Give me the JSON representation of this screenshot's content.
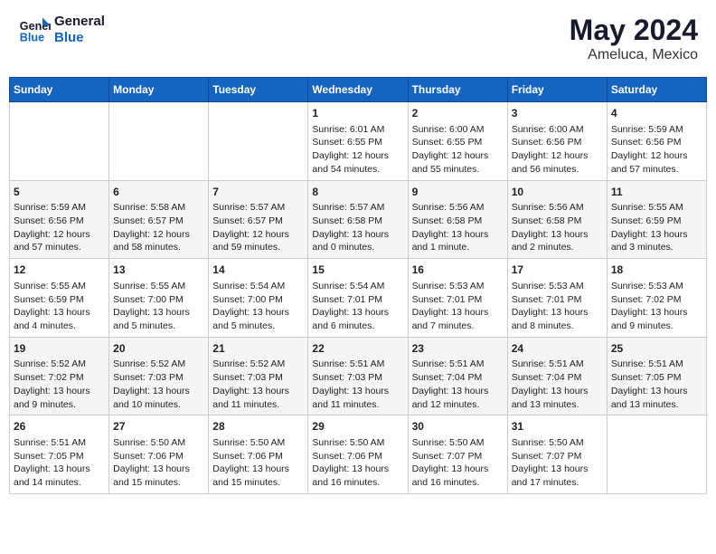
{
  "header": {
    "logo_line1": "General",
    "logo_line2": "Blue",
    "title": "May 2024",
    "subtitle": "Ameluca, Mexico"
  },
  "days_of_week": [
    "Sunday",
    "Monday",
    "Tuesday",
    "Wednesday",
    "Thursday",
    "Friday",
    "Saturday"
  ],
  "weeks": [
    [
      {
        "day": "",
        "info": ""
      },
      {
        "day": "",
        "info": ""
      },
      {
        "day": "",
        "info": ""
      },
      {
        "day": "1",
        "info": "Sunrise: 6:01 AM\nSunset: 6:55 PM\nDaylight: 12 hours\nand 54 minutes."
      },
      {
        "day": "2",
        "info": "Sunrise: 6:00 AM\nSunset: 6:55 PM\nDaylight: 12 hours\nand 55 minutes."
      },
      {
        "day": "3",
        "info": "Sunrise: 6:00 AM\nSunset: 6:56 PM\nDaylight: 12 hours\nand 56 minutes."
      },
      {
        "day": "4",
        "info": "Sunrise: 5:59 AM\nSunset: 6:56 PM\nDaylight: 12 hours\nand 57 minutes."
      }
    ],
    [
      {
        "day": "5",
        "info": "Sunrise: 5:59 AM\nSunset: 6:56 PM\nDaylight: 12 hours\nand 57 minutes."
      },
      {
        "day": "6",
        "info": "Sunrise: 5:58 AM\nSunset: 6:57 PM\nDaylight: 12 hours\nand 58 minutes."
      },
      {
        "day": "7",
        "info": "Sunrise: 5:57 AM\nSunset: 6:57 PM\nDaylight: 12 hours\nand 59 minutes."
      },
      {
        "day": "8",
        "info": "Sunrise: 5:57 AM\nSunset: 6:58 PM\nDaylight: 13 hours\nand 0 minutes."
      },
      {
        "day": "9",
        "info": "Sunrise: 5:56 AM\nSunset: 6:58 PM\nDaylight: 13 hours\nand 1 minute."
      },
      {
        "day": "10",
        "info": "Sunrise: 5:56 AM\nSunset: 6:58 PM\nDaylight: 13 hours\nand 2 minutes."
      },
      {
        "day": "11",
        "info": "Sunrise: 5:55 AM\nSunset: 6:59 PM\nDaylight: 13 hours\nand 3 minutes."
      }
    ],
    [
      {
        "day": "12",
        "info": "Sunrise: 5:55 AM\nSunset: 6:59 PM\nDaylight: 13 hours\nand 4 minutes."
      },
      {
        "day": "13",
        "info": "Sunrise: 5:55 AM\nSunset: 7:00 PM\nDaylight: 13 hours\nand 5 minutes."
      },
      {
        "day": "14",
        "info": "Sunrise: 5:54 AM\nSunset: 7:00 PM\nDaylight: 13 hours\nand 5 minutes."
      },
      {
        "day": "15",
        "info": "Sunrise: 5:54 AM\nSunset: 7:01 PM\nDaylight: 13 hours\nand 6 minutes."
      },
      {
        "day": "16",
        "info": "Sunrise: 5:53 AM\nSunset: 7:01 PM\nDaylight: 13 hours\nand 7 minutes."
      },
      {
        "day": "17",
        "info": "Sunrise: 5:53 AM\nSunset: 7:01 PM\nDaylight: 13 hours\nand 8 minutes."
      },
      {
        "day": "18",
        "info": "Sunrise: 5:53 AM\nSunset: 7:02 PM\nDaylight: 13 hours\nand 9 minutes."
      }
    ],
    [
      {
        "day": "19",
        "info": "Sunrise: 5:52 AM\nSunset: 7:02 PM\nDaylight: 13 hours\nand 9 minutes."
      },
      {
        "day": "20",
        "info": "Sunrise: 5:52 AM\nSunset: 7:03 PM\nDaylight: 13 hours\nand 10 minutes."
      },
      {
        "day": "21",
        "info": "Sunrise: 5:52 AM\nSunset: 7:03 PM\nDaylight: 13 hours\nand 11 minutes."
      },
      {
        "day": "22",
        "info": "Sunrise: 5:51 AM\nSunset: 7:03 PM\nDaylight: 13 hours\nand 11 minutes."
      },
      {
        "day": "23",
        "info": "Sunrise: 5:51 AM\nSunset: 7:04 PM\nDaylight: 13 hours\nand 12 minutes."
      },
      {
        "day": "24",
        "info": "Sunrise: 5:51 AM\nSunset: 7:04 PM\nDaylight: 13 hours\nand 13 minutes."
      },
      {
        "day": "25",
        "info": "Sunrise: 5:51 AM\nSunset: 7:05 PM\nDaylight: 13 hours\nand 13 minutes."
      }
    ],
    [
      {
        "day": "26",
        "info": "Sunrise: 5:51 AM\nSunset: 7:05 PM\nDaylight: 13 hours\nand 14 minutes."
      },
      {
        "day": "27",
        "info": "Sunrise: 5:50 AM\nSunset: 7:06 PM\nDaylight: 13 hours\nand 15 minutes."
      },
      {
        "day": "28",
        "info": "Sunrise: 5:50 AM\nSunset: 7:06 PM\nDaylight: 13 hours\nand 15 minutes."
      },
      {
        "day": "29",
        "info": "Sunrise: 5:50 AM\nSunset: 7:06 PM\nDaylight: 13 hours\nand 16 minutes."
      },
      {
        "day": "30",
        "info": "Sunrise: 5:50 AM\nSunset: 7:07 PM\nDaylight: 13 hours\nand 16 minutes."
      },
      {
        "day": "31",
        "info": "Sunrise: 5:50 AM\nSunset: 7:07 PM\nDaylight: 13 hours\nand 17 minutes."
      },
      {
        "day": "",
        "info": ""
      }
    ]
  ]
}
